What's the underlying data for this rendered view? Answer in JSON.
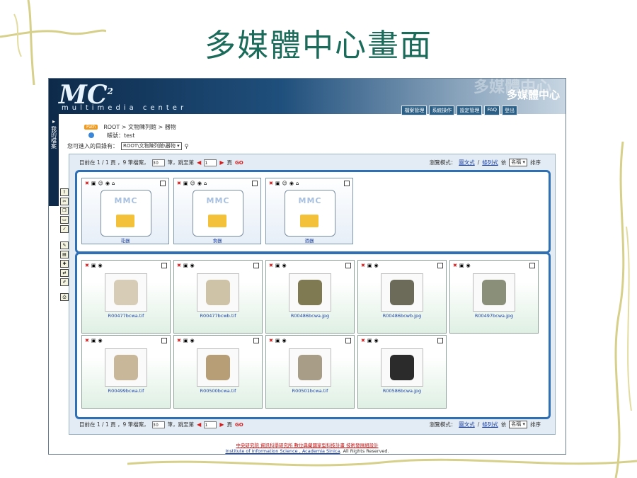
{
  "slide": {
    "title": "多媒體中心畫面"
  },
  "header": {
    "logo_text": "MC",
    "logo_superscript": "2",
    "subtitle": "multimedia center",
    "brand": "多媒體中心",
    "ghost_text": "多媒體中心",
    "nav": [
      "檔案管理",
      "系統操作",
      "設定管理",
      "FAQ",
      "登出"
    ]
  },
  "sidebar": {
    "label": "我的檔案"
  },
  "breadcrumb": {
    "path_badge": "Path",
    "path": "ROOT > 文物陳列館 > 器物",
    "account_label": "帳號：test"
  },
  "directory": {
    "label": "您可進入的目錄有：",
    "selected": "ROOT\\文物陳列館\\器物"
  },
  "pager": {
    "prefix": "目前在 1 / 1 頁 ，9 筆檔案，",
    "per_page": "30",
    "mid": "筆，跳至第",
    "page": "1",
    "suffix": "頁",
    "go": "GO"
  },
  "view": {
    "label": "瀏覽模式：",
    "mode1": "圖文式",
    "sep": "/",
    "mode2": "條列式",
    "sort_by": "依",
    "sort_field": "名稱",
    "sort_label": "排序"
  },
  "folders": [
    {
      "name": "花器",
      "badge": "MMC"
    },
    {
      "name": "食器",
      "badge": "MMC"
    },
    {
      "name": "酒器",
      "badge": "MMC"
    }
  ],
  "files": [
    {
      "name": "R00477bcwa.tif",
      "thumb_color": "#d7ccb6"
    },
    {
      "name": "R00477bcwb.tif",
      "thumb_color": "#cfc3a7"
    },
    {
      "name": "R00486bcwa.jpg",
      "thumb_color": "#7f7a52"
    },
    {
      "name": "R00486bcwb.jpg",
      "thumb_color": "#6c6a58"
    },
    {
      "name": "R00497bcwa.jpg",
      "thumb_color": "#8a8f7a"
    },
    {
      "name": "R00499bcwa.tif",
      "thumb_color": "#c9b79a"
    },
    {
      "name": "R00500bcwa.tif",
      "thumb_color": "#b89e77"
    },
    {
      "name": "R00501bcwa.tif",
      "thumb_color": "#a89d86"
    },
    {
      "name": "R00586bcwa.jpg",
      "thumb_color": "#2b2b2b"
    }
  ],
  "footer": {
    "line1": "中央研究院 資訊科學研究所 數位典藏國家型科技計畫 技術發展組設計",
    "line2_link": "Institute of Information Science , Academia Sinica",
    "line2_rest": ". All Rights Reserved."
  }
}
